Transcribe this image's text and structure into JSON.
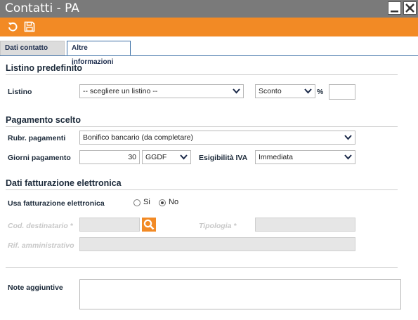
{
  "window": {
    "title": "Contatti - PA"
  },
  "tabs": {
    "dati_contatto": "Dati contatto",
    "altre_informazioni": "Altre informazioni"
  },
  "listino": {
    "section": "Listino predefinito",
    "label": "Listino",
    "select_value": "-- scegliere un listino --",
    "sconto_value": "Sconto",
    "percent": "%",
    "sconto_input": ""
  },
  "pagamento": {
    "section": "Pagamento scelto",
    "rubr_label": "Rubr. pagamenti",
    "rubr_value": "Bonifico bancario (da completare)",
    "giorni_label": "Giorni pagamento",
    "giorni_value": "30",
    "giorni_unit": "GGDF",
    "esig_label": "Esigibilità IVA",
    "esig_value": "Immediata"
  },
  "fatturazione": {
    "section": "Dati fatturazione elettronica",
    "usa_label": "Usa fatturazione elettronica",
    "option_si": "Si",
    "option_no": "No",
    "selected": "No",
    "cod_label": "Cod. destinatario *",
    "tipologia_label": "Tipologia *",
    "rif_label": "Rif. amministrativo"
  },
  "note": {
    "label": "Note aggiuntive",
    "value": ""
  },
  "colors": {
    "accent": "#f28a25",
    "titlebar": "#7a7a7a",
    "tab_border": "#3a6ea5"
  },
  "icons": {
    "undo": "undo-icon",
    "save": "save-icon",
    "search": "search-icon",
    "minimize": "minimize-icon",
    "close": "close-icon"
  }
}
